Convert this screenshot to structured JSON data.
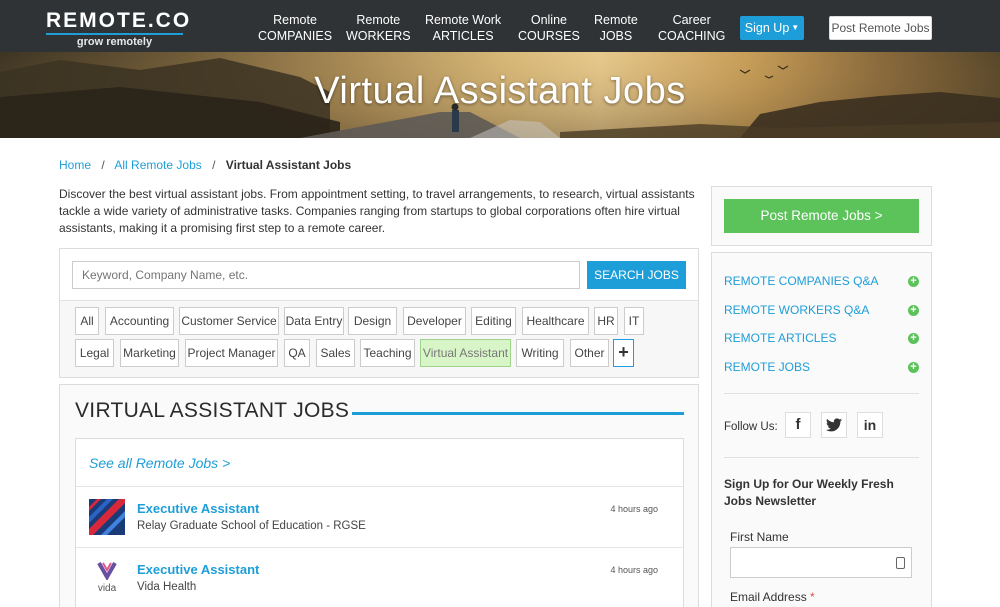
{
  "brand": {
    "name": "REMOTE.CO",
    "tagline": "grow remotely"
  },
  "nav": {
    "items": [
      {
        "line1": "Remote",
        "line2": "COMPANIES"
      },
      {
        "line1": "Remote",
        "line2": "WORKERS"
      },
      {
        "line1": "Remote Work",
        "line2": "ARTICLES"
      },
      {
        "line1": "Online",
        "line2": "COURSES"
      },
      {
        "line1": "Remote",
        "line2": "JOBS"
      },
      {
        "line1": "Career",
        "line2": "COACHING"
      }
    ],
    "signup_label": "Sign Up",
    "post_jobs_label": "Post Remote Jobs"
  },
  "hero": {
    "title": "Virtual Assistant Jobs"
  },
  "breadcrumb": {
    "home": "Home",
    "all_jobs": "All Remote Jobs",
    "current": "Virtual Assistant Jobs",
    "separator": "/"
  },
  "intro_text": "Discover the best virtual assistant jobs. From appointment setting, to travel arrangements, to research, virtual assistants tackle a wide variety of administrative tasks. Companies ranging from startups to global corporations often hire virtual assistants, making it a promising first step to a remote career.",
  "search": {
    "placeholder": "Keyword, Company Name, etc.",
    "button_label": "SEARCH JOBS"
  },
  "categories": {
    "row1": [
      "All",
      "Accounting",
      "Customer Service",
      "Data Entry",
      "Design",
      "Developer",
      "Editing",
      "Healthcare",
      "HR",
      "IT"
    ],
    "row2": [
      "Legal",
      "Marketing",
      "Project Manager",
      "QA",
      "Sales",
      "Teaching",
      "Virtual Assistant",
      "Writing",
      "Other"
    ],
    "active": "Virtual Assistant",
    "more_label": "+"
  },
  "jobs": {
    "heading": "VIRTUAL ASSISTANT JOBS",
    "see_all_label": "See all Remote Jobs >",
    "items": [
      {
        "title": "Executive Assistant",
        "company": "Relay Graduate School of Education - RGSE",
        "posted": "4 hours ago"
      },
      {
        "title": "Executive Assistant",
        "company": "Vida Health",
        "posted": "4 hours ago",
        "logo_text": "vida"
      }
    ]
  },
  "sidebar": {
    "post_button_label": "Post Remote Jobs >",
    "links": [
      "REMOTE COMPANIES Q&A",
      "REMOTE WORKERS Q&A",
      "REMOTE ARTICLES",
      "REMOTE JOBS"
    ],
    "follow_label": "Follow Us:",
    "social": [
      {
        "icon": "facebook-icon",
        "glyph": "f"
      },
      {
        "icon": "twitter-icon",
        "glyph": "t"
      },
      {
        "icon": "linkedin-icon",
        "glyph": "in"
      }
    ],
    "newsletter": {
      "title": "Sign Up for Our Weekly Fresh Jobs Newsletter",
      "first_name_label": "First Name",
      "email_label": "Email Address",
      "required_mark": "*"
    }
  },
  "colors": {
    "accent": "#1e9ed8",
    "nav_bg": "#2f3336",
    "green": "#5cc25a",
    "active_tag": "#d8f5c8"
  }
}
